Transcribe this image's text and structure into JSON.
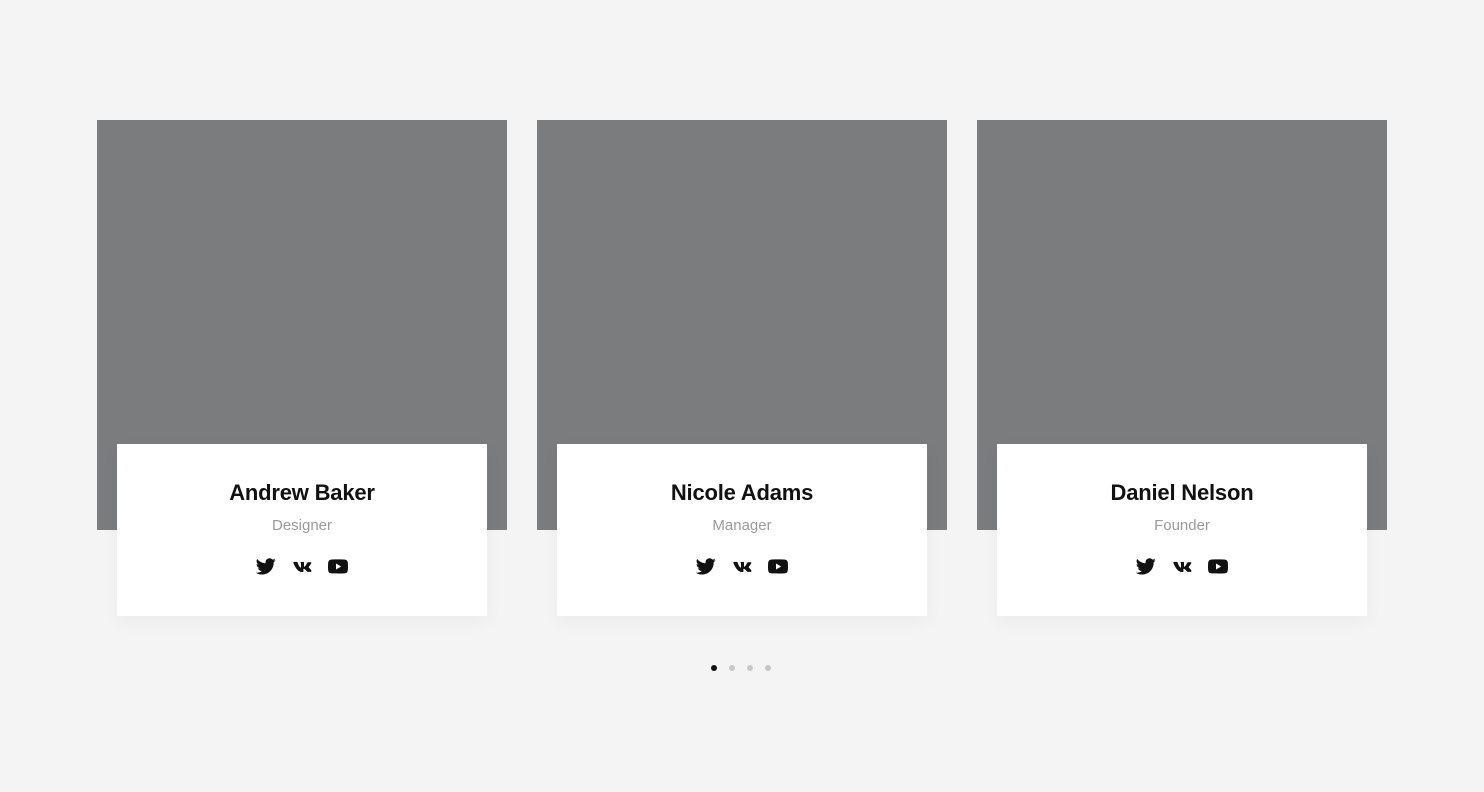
{
  "team": [
    {
      "name": "Andrew Baker",
      "role": "Designer",
      "socials": [
        "twitter-icon",
        "vk-icon",
        "youtube-icon"
      ]
    },
    {
      "name": "Nicole Adams",
      "role": "Manager",
      "socials": [
        "twitter-icon",
        "vk-icon",
        "youtube-icon"
      ]
    },
    {
      "name": "Daniel Nelson",
      "role": "Founder",
      "socials": [
        "twitter-icon",
        "vk-icon",
        "youtube-icon"
      ]
    }
  ],
  "pagination": {
    "total": 4,
    "active": 1
  },
  "colors": {
    "background": "#f4f4f4",
    "photo_placeholder": "#7b7c7d",
    "card": "#ffffff",
    "name": "#111111",
    "role": "#9a9a9a",
    "dot_active": "#111111",
    "dot_inactive": "#c8c8c8"
  }
}
